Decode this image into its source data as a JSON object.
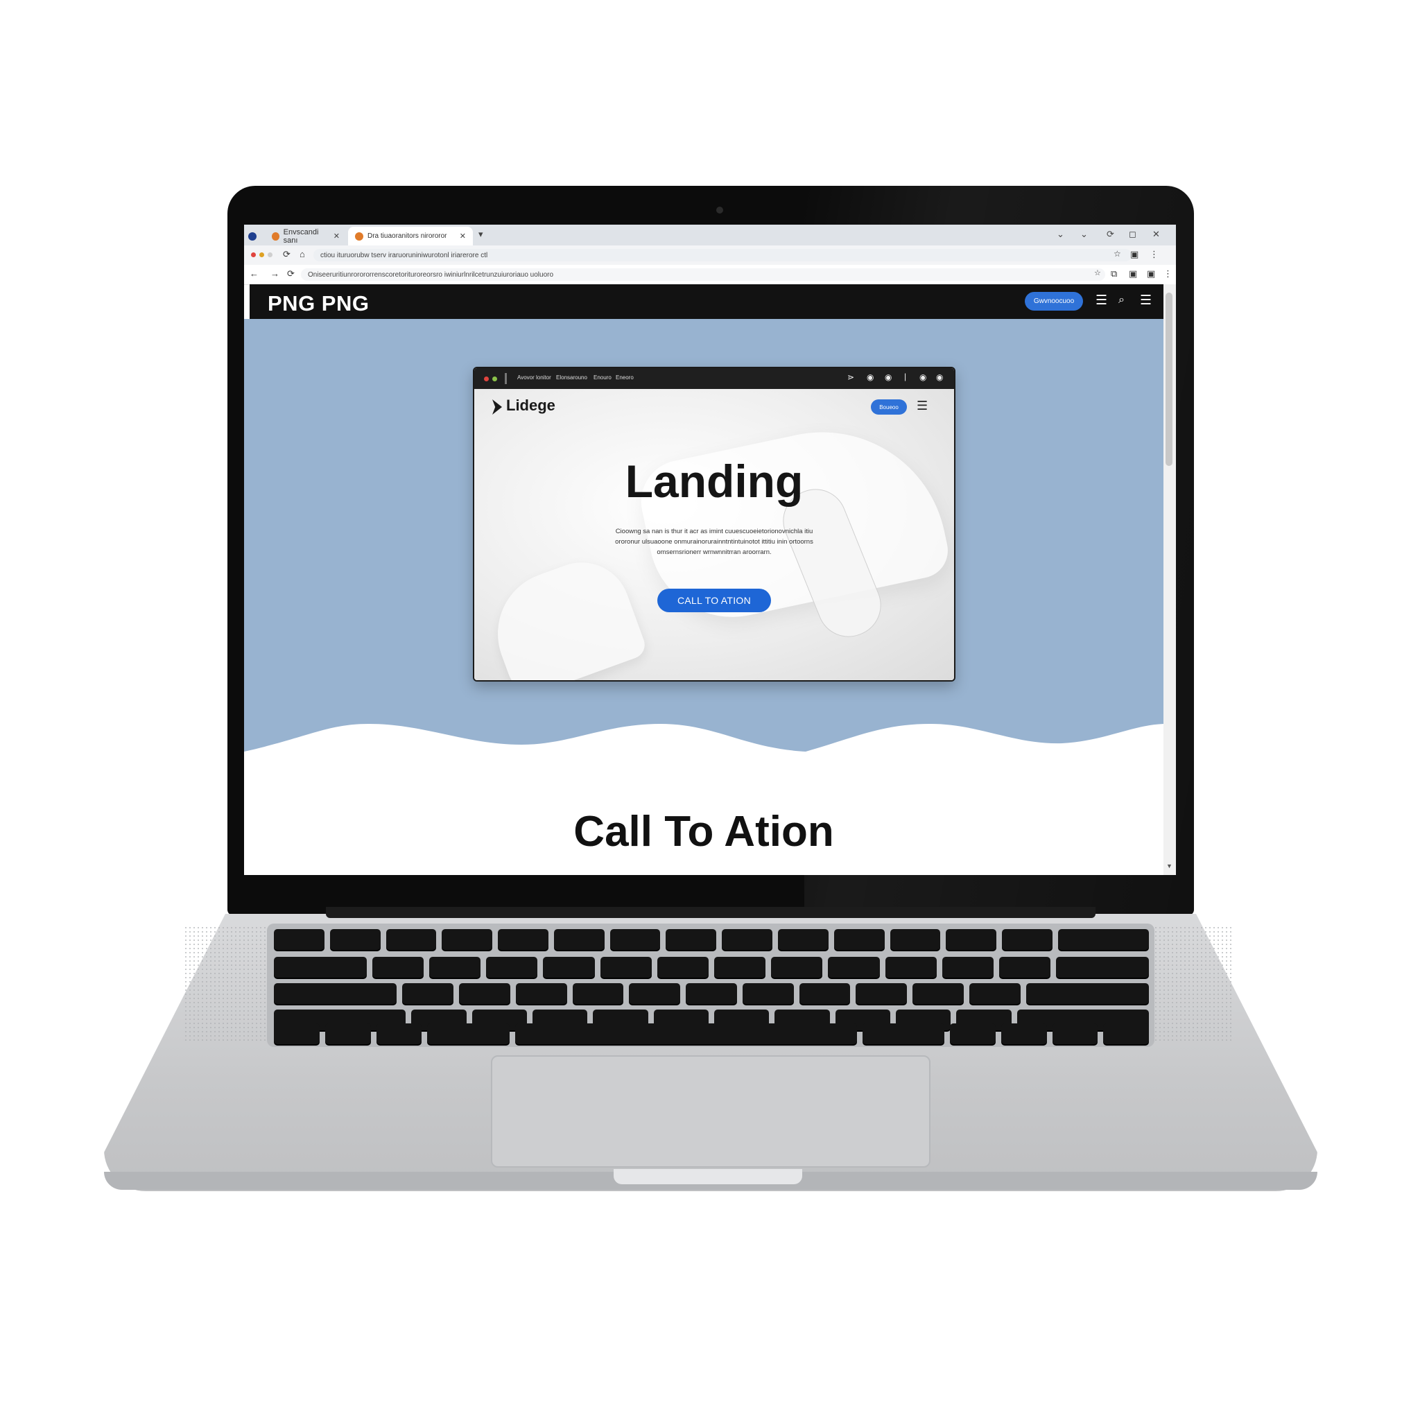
{
  "browser": {
    "tabs": [
      {
        "label": "Envscandi sanı"
      },
      {
        "label": "Dra tiuaoranitors nirororor"
      }
    ],
    "address_top": "ctiou ituruorubw tserv iraruoruniniwurotonl iriarerore ctl",
    "address_url": "Oniseeruritiunrorororrenscoretorituroreorsro iwiniurlnrilcetrunzuiuroriauo uoluoro"
  },
  "site": {
    "brand": "PNG PNG",
    "nav_button": "Gwvnoocuoo",
    "nav_icons": [
      "menu-icon",
      "search-icon",
      "hamburger-icon"
    ]
  },
  "mockup": {
    "tabs": [
      "Avovor lonitor",
      "Elonsarouno",
      "Enouro",
      "Eneoro"
    ],
    "logo": "Lidege",
    "nav_button": "Boueoo",
    "title": "Landing",
    "description": "Cioowng sa nan is thur it acr as imint cuuescuoeietorionovnichla itiu ororonur ulsuaoone onmurainorurainntntintuinotot ittitiu inin ortoorns omsernsrionerr wrnwnnitrran aroorrarn.",
    "cta": "CALL TO ATION"
  },
  "section": {
    "heading": "Call To Ation"
  },
  "colors": {
    "hero_bg": "#98b3d0",
    "accent": "#1e66d6",
    "nav_bg": "#121212"
  }
}
